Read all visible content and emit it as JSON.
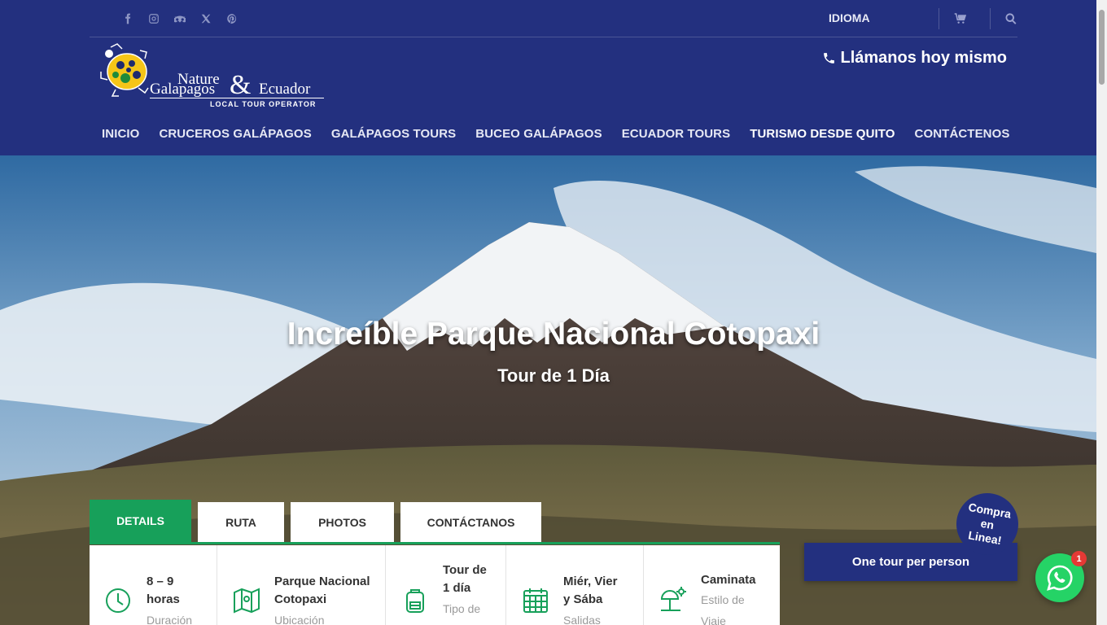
{
  "social_icons": [
    "facebook-icon",
    "instagram-icon",
    "tripadvisor-icon",
    "x-twitter-icon",
    "pinterest-icon"
  ],
  "topbar": {
    "language_label": "IDIOMA"
  },
  "logo": {
    "line1": "Nature",
    "line2": "&",
    "line3": "Galapagos",
    "line4": "Ecuador",
    "tagline": "LOCAL TOUR OPERATOR"
  },
  "phone": {
    "label": "Llámanos hoy mismo"
  },
  "nav": {
    "items": [
      {
        "label": "INICIO"
      },
      {
        "label": "CRUCEROS GALÁPAGOS"
      },
      {
        "label": "GALÁPAGOS TOURS"
      },
      {
        "label": "BUCEO GALÁPAGOS"
      },
      {
        "label": "ECUADOR TOURS"
      },
      {
        "label": "TURISMO DESDE QUITO"
      },
      {
        "label": "CONTÁCTENOS"
      }
    ]
  },
  "hero": {
    "title": "Increíble Parque Nacional Cotopaxi",
    "subtitle": "Tour de 1 Día"
  },
  "tabs": [
    {
      "label": "DETAILS"
    },
    {
      "label": "RUTA"
    },
    {
      "label": "PHOTOS"
    },
    {
      "label": "CONTÁCTANOS"
    }
  ],
  "details": [
    {
      "icon": "clock-icon",
      "value_line1": "8 – 9",
      "value_line2": "horas",
      "label": "Duración"
    },
    {
      "icon": "map-icon",
      "value_line1": "Parque Nacional",
      "value_line2": "Cotopaxi",
      "label": "Ubicación"
    },
    {
      "icon": "backpack-icon",
      "value_line1": "Tour de",
      "value_line2": "1 día",
      "label": "Tipo de"
    },
    {
      "icon": "calendar-icon",
      "value_line1": "Miér, Vier",
      "value_line2": "y Sába",
      "label": "Salidas"
    },
    {
      "icon": "beach-icon",
      "value_line1": "Caminata",
      "value_line2": "",
      "label": "Estilo de",
      "label2": "Viaje"
    }
  ],
  "price_box": {
    "label": "One tour per person"
  },
  "buy_badge": {
    "line1": "Compra",
    "line2": "en",
    "line3": "Linea!"
  },
  "whatsapp": {
    "badge_count": "1"
  },
  "colors": {
    "brand_blue": "#23307f",
    "accent_green": "#17a05a",
    "whatsapp_green": "#25d366"
  }
}
